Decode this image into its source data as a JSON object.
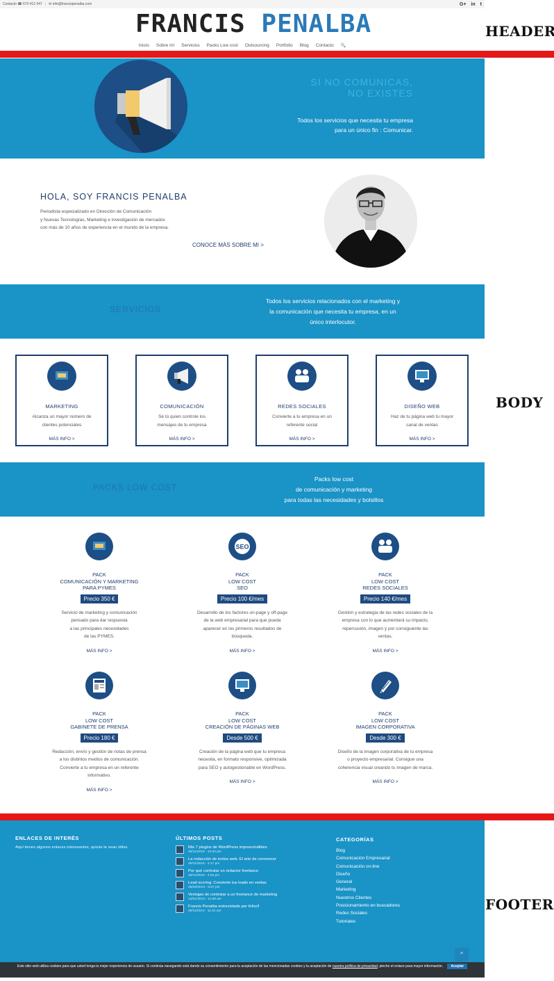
{
  "topbar": {
    "contact": "Contacto ☎ 670 412 047",
    "email": "✉ info@francispenalba.com",
    "social": [
      "G+",
      "in",
      "t"
    ]
  },
  "logo": {
    "part1": "FRANCIS",
    "part2": "PENALBA"
  },
  "nav": [
    "Inicio",
    "Sobre mí",
    "Servicios",
    "Packs Low cost",
    "Outsourcing",
    "Portfolio",
    "Blog",
    "Contacto",
    "🔍"
  ],
  "labels": {
    "header": "HEADER",
    "body": "BODY",
    "footer": "FOOTER"
  },
  "hero": {
    "title_line1": "SI NO COMUNICAS,",
    "title_line2": "NO EXISTES",
    "sub_line1": "Todos los servicios que necesita tu empresa",
    "sub_line2": "para un único fin : Comunicar."
  },
  "about": {
    "title": "HOLA, SOY FRANCIS PENALBA",
    "line1": "Periodista especializado en Dirección de Comunicación",
    "line2": "y Nuevas Tecnologías, Marketing e investigación de mercados",
    "line3": "con más de 10 años de experiencia en el mundo de la empresa.",
    "link": "CONOCE MÁS SOBRE MI >"
  },
  "services_band": {
    "title": "SERVICIOS",
    "line1": "Todos los servicios relacionados con el marketing y",
    "line2": "la comunicación que necesita tu empresa, en un",
    "line3": "único interlocutor."
  },
  "cards": [
    {
      "title": "MARKETING",
      "line1": "Alcanza un mayor número de",
      "line2": "clientes potenciales",
      "more": "MÁS INFO >"
    },
    {
      "title": "COMUNICACIÓN",
      "line1": "Sé tú quien controle los",
      "line2": "mensajes de tu empresa",
      "more": "MÁS INFO >"
    },
    {
      "title": "REDES SOCIALES",
      "line1": "Convierte a tu empresa en un",
      "line2": "referente social",
      "more": "MÁS INFO >"
    },
    {
      "title": "DISEÑO WEB",
      "line1": "Haz de tu página web tu mayor",
      "line2": "canal de ventas",
      "more": "MÁS INFO >"
    }
  ],
  "packs_band": {
    "title": "PACKS LOW COST",
    "line1": "Packs low cost",
    "line2": "de comunicación y marketing",
    "line3": "para todas las necesidades y bolsillos"
  },
  "packs": [
    {
      "title": "PACK\nCOMUNICACIÓN Y MARKETING\nPARA PYMES",
      "price": "Precio 350 €",
      "text": "Servicio de marketing y comunicación\npensado para dar respuesta\na las principales necesidades\nde las PYMES.",
      "more": "MÁS INFO >"
    },
    {
      "title": "PACK\nLOW COST\nSEO",
      "price": "Precio 100 €/mes",
      "text": "Desarrollo de los factores on-page y off-page\nde la web empresarial para que pueda\naparecer en los primeros resultados de\nbúsqueda.",
      "more": "MÁS INFO >"
    },
    {
      "title": "PACK\nLOW COST\nREDES SOCIALES",
      "price": "Precio 140 €/mes",
      "text": "Gestión y estrategia de las redes sociales de la\nempresa con lo que aumentará su impacto,\nrepercusión, imagen y por consiguiente las\nventas.",
      "more": "MÁS INFO >"
    },
    {
      "title": "PACK\nLOW COST\nGABINETE DE PRENSA",
      "price": "Precio 180 €",
      "text": "Redacción, envío y gestión de notas de prensa\na los distintos medios de comunicación.\nConvierte a tu empresa en un referente\ninformativo.",
      "more": "MÁS INFO >"
    },
    {
      "title": "PACK\nLOW COST\nCREACIÓN DE PÁGINAS WEB",
      "price": "Desde 500 €",
      "text": "Creación de la página web que tu empresa\nnecesita, en formato responsive, optimizada\npara SEO y autogestionable en WordPress.",
      "more": "MÁS INFO >"
    },
    {
      "title": "PACK\nLOW COST\nIMAGEN CORPORATIVA",
      "price": "Desde 300 €",
      "text": "Diseño de la imagen corporativa de tu empresa\no proyecto empresarial. Consigue una\ncoherencia visual creando tu imagen de marca.",
      "more": "MÁS INFO >"
    }
  ],
  "footer": {
    "links_title": "ENLACES DE INTERÉS",
    "links_text": "Aquí tienes algunos enlaces interesantes, quizás te sean útiles.",
    "posts_title": "ÚLTIMOS POSTS",
    "posts": [
      {
        "title": "Mis 7 plugins de WordPress imprescindibles",
        "date": "26/11/2018 - 10:32 pm"
      },
      {
        "title": "La redacción de textos web. El arte de convencer",
        "date": "30/11/2016 - 4:17 pm"
      },
      {
        "title": "Por qué contratar un redactor freelance",
        "date": "16/11/2016 - 4:04 pm"
      },
      {
        "title": "Lead scoring: Convierte tus leads en ventas",
        "date": "26/03/2013 - 5:57 pm"
      },
      {
        "title": "Ventajas de contratar a un freelance de marketing",
        "date": "14/01/2013 - 11:58 am"
      },
      {
        "title": "Francis Penalba entrevistado por Infocif",
        "date": "28/11/2014 - 11:01 am"
      }
    ],
    "cats_title": "CATEGORÍAS",
    "cats": [
      "Blog",
      "Comunicación Empresarial",
      "Comunicación on-line",
      "Diseño",
      "General",
      "Marketing",
      "Nuestros Clientes",
      "Posicionamiento en buscadores",
      "Redes Sociales",
      "Tutoriales"
    ]
  },
  "cookie": {
    "text1": "Este sitio web utiliza cookies para que usted tenga la mejor experiencia de usuario. Si continúa navegando está dando su consentimiento para la aceptación de las mencionadas cookies y la aceptación de ",
    "link": "nuestra política de privacidad",
    "text2": ", pinche el enlace para mayor información.",
    "button": "Aceptar"
  }
}
